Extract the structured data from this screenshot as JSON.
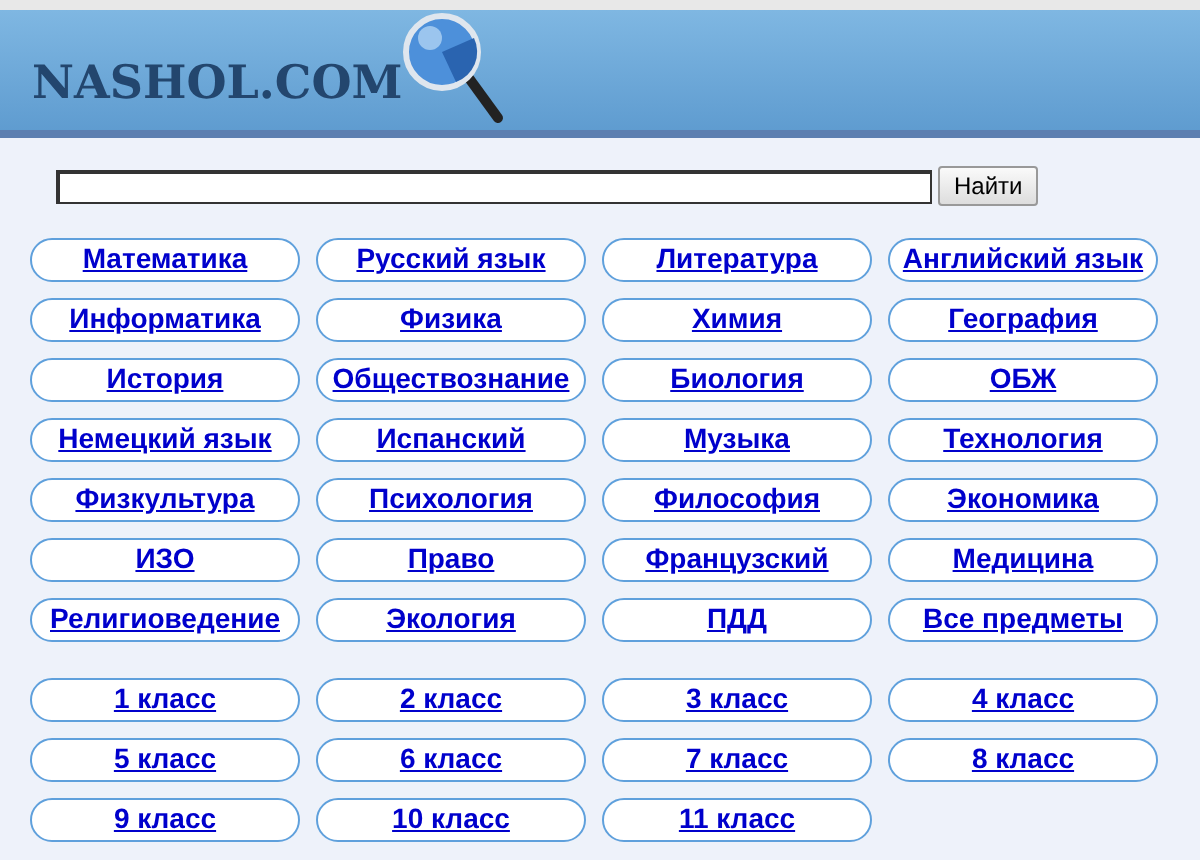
{
  "header": {
    "logo": "NASHOL.COM"
  },
  "search": {
    "button": "Найти"
  },
  "subjects": [
    {
      "label": "Математика"
    },
    {
      "label": "Русский язык"
    },
    {
      "label": "Литература"
    },
    {
      "label": "Английский язык"
    },
    {
      "label": "Информатика"
    },
    {
      "label": "Физика"
    },
    {
      "label": "Химия"
    },
    {
      "label": "География"
    },
    {
      "label": "История"
    },
    {
      "label": "Обществознание"
    },
    {
      "label": "Биология"
    },
    {
      "label": "ОБЖ"
    },
    {
      "label": "Немецкий язык"
    },
    {
      "label": "Испанский"
    },
    {
      "label": "Музыка"
    },
    {
      "label": "Технология"
    },
    {
      "label": "Физкультура"
    },
    {
      "label": "Психология"
    },
    {
      "label": "Философия"
    },
    {
      "label": "Экономика"
    },
    {
      "label": "ИЗО"
    },
    {
      "label": "Право"
    },
    {
      "label": "Французский"
    },
    {
      "label": "Медицина"
    },
    {
      "label": "Религиоведение"
    },
    {
      "label": "Экология"
    },
    {
      "label": "ПДД"
    },
    {
      "label": "Все предметы"
    }
  ],
  "classes": [
    {
      "label": "1 класс"
    },
    {
      "label": "2 класс"
    },
    {
      "label": "3 класс"
    },
    {
      "label": "4 класс"
    },
    {
      "label": "5 класс"
    },
    {
      "label": "6 класс"
    },
    {
      "label": "7 класс"
    },
    {
      "label": "8 класс"
    },
    {
      "label": "9 класс"
    },
    {
      "label": "10 класс"
    },
    {
      "label": "11 класс"
    }
  ]
}
